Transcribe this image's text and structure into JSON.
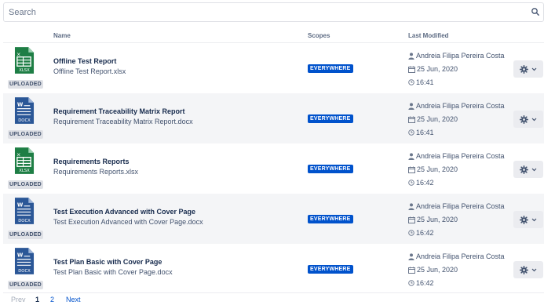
{
  "search": {
    "placeholder": "Search"
  },
  "table": {
    "headers": {
      "name": "Name",
      "scopes": "Scopes",
      "last_modified": "Last Modified"
    },
    "rows": [
      {
        "type": "xlsx",
        "type_label": "XLSX",
        "badge": "UPLOADED",
        "title": "Offline Test Report",
        "filename": "Offline Test Report.xlsx",
        "scope": "EVERYWHERE",
        "user": "Andreia Filipa Pereira Costa",
        "date": "25 Jun, 2020",
        "time": "16:41"
      },
      {
        "type": "docx",
        "type_label": "DOCX",
        "badge": "UPLOADED",
        "title": "Requirement Traceability Matrix Report",
        "filename": "Requirement Traceability Matrix Report.docx",
        "scope": "EVERYWHERE",
        "user": "Andreia Filipa Pereira Costa",
        "date": "25 Jun, 2020",
        "time": "16:41"
      },
      {
        "type": "xlsx",
        "type_label": "XLSX",
        "badge": "UPLOADED",
        "title": "Requirements Reports",
        "filename": "Requirements Reports.xlsx",
        "scope": "EVERYWHERE",
        "user": "Andreia Filipa Pereira Costa",
        "date": "25 Jun, 2020",
        "time": "16:42"
      },
      {
        "type": "docx",
        "type_label": "DOCX",
        "badge": "UPLOADED",
        "title": "Test Execution Advanced with Cover Page",
        "filename": "Test Execution Advanced with Cover Page.docx",
        "scope": "EVERYWHERE",
        "user": "Andreia Filipa Pereira Costa",
        "date": "25 Jun, 2020",
        "time": "16:42"
      },
      {
        "type": "docx",
        "type_label": "DOCX",
        "badge": "UPLOADED",
        "title": "Test Plan Basic with Cover Page",
        "filename": "Test Plan Basic with Cover Page.docx",
        "scope": "EVERYWHERE",
        "user": "Andreia Filipa Pereira Costa",
        "date": "25 Jun, 2020",
        "time": "16:42"
      }
    ]
  },
  "pagination": {
    "prev": "Prev",
    "page1": "1",
    "page2": "2",
    "next": "Next"
  },
  "colors": {
    "xlsx": "#1e7e45",
    "docx": "#2b5797",
    "scope_badge": "#0052cc",
    "row_alt": "#f4f5f7"
  },
  "icons": {
    "search": "search-icon",
    "user": "user-icon",
    "date": "calendar-icon",
    "time": "clock-icon",
    "actions": "gear-icon",
    "dropdown": "chevron-down-icon",
    "xlsx": "xlsx-file-icon",
    "docx": "docx-file-icon"
  }
}
